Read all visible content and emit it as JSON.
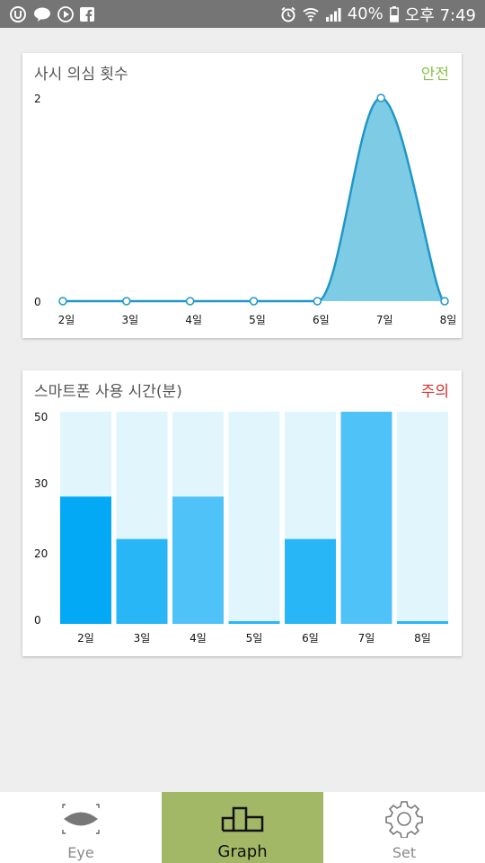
{
  "status_bar": {
    "battery": "40%",
    "time": "오후 7:49",
    "left_icons": [
      "u-plus-icon",
      "kakaotalk-icon",
      "play-icon",
      "facebook-icon"
    ],
    "right_icons": [
      "alarm-icon",
      "wifi-icon",
      "signal-icon",
      "battery-icon"
    ]
  },
  "card1": {
    "title": "사시 의심 횟수",
    "status": "안전",
    "status_color": "#8bc34a",
    "chart_data": {
      "type": "area",
      "categories": [
        "2일",
        "3일",
        "4일",
        "5일",
        "6일",
        "7일",
        "8일"
      ],
      "values": [
        0,
        0,
        0,
        0,
        0,
        2,
        0
      ],
      "ylim": [
        0,
        2
      ],
      "yticks": [
        "2",
        "0"
      ],
      "fill_color": "#7ecbe6",
      "line_color": "#1e97c8"
    }
  },
  "card2": {
    "title": "스마트폰 사용 시간(분)",
    "status": "주의",
    "status_color": "#d32f2f",
    "chart_data": {
      "type": "bar",
      "categories": [
        "2일",
        "3일",
        "4일",
        "5일",
        "6일",
        "7일",
        "8일"
      ],
      "values": [
        30,
        20,
        30,
        0,
        20,
        50,
        0
      ],
      "ylim": [
        0,
        50
      ],
      "yticks": [
        "50",
        "30",
        "20",
        "0"
      ],
      "bar_colors": [
        "#03a9f4",
        "#29b6f6",
        "#4fc3f7",
        "#29b6f6",
        "#29b6f6",
        "#4fc3f7",
        "#29b6f6"
      ],
      "background_color": "#e1f5fc"
    }
  },
  "bottom_nav": {
    "items": [
      {
        "label": "Eye",
        "icon": "eye-icon"
      },
      {
        "label": "Graph",
        "icon": "graph-icon"
      },
      {
        "label": "Set",
        "icon": "gear-icon"
      }
    ],
    "active": 1,
    "active_color": "#a3b866"
  }
}
